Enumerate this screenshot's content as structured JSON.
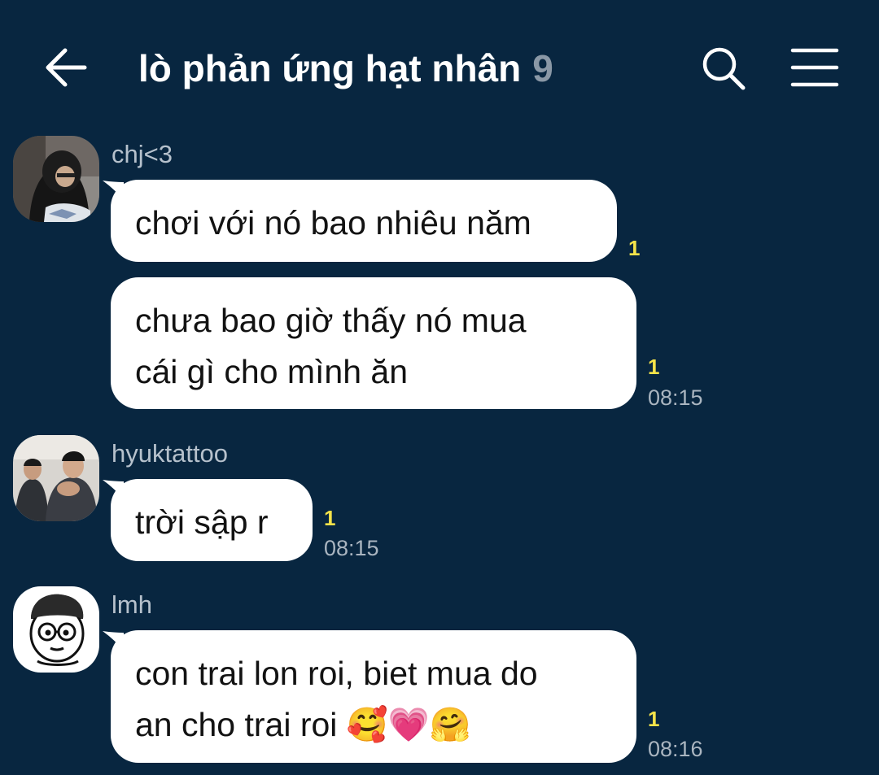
{
  "header": {
    "back_icon": "arrow-left-icon",
    "title": "lò phản ứng hạt nhân",
    "member_count": "9",
    "search_icon": "search-icon",
    "menu_icon": "hamburger-menu-icon"
  },
  "colors": {
    "background": "#082640",
    "bubble": "#ffffff",
    "unread": "#f5e34a",
    "meta_text": "#aab5c0"
  },
  "messages": [
    {
      "sender": "chj<3",
      "avatar": "photo-person-hoodie",
      "bubbles": [
        {
          "lines": [
            "chơi với nó bao nhiêu năm"
          ],
          "unread": "1",
          "time": ""
        },
        {
          "lines": [
            "chưa bao giờ thấy nó mua",
            "cái gì cho mình ăn"
          ],
          "unread": "1",
          "time": "08:15"
        }
      ]
    },
    {
      "sender": "hyuktattoo",
      "avatar": "photo-two-people",
      "bubbles": [
        {
          "lines": [
            "trời sập r"
          ],
          "unread": "1",
          "time": "08:15"
        }
      ]
    },
    {
      "sender": "lmh",
      "avatar": "cartoon-face-glasses",
      "bubbles": [
        {
          "lines": [
            "con trai lon roi, biet mua do",
            "an cho trai roi 🥰💗🤗"
          ],
          "unread": "1",
          "time": "08:16"
        }
      ]
    }
  ]
}
